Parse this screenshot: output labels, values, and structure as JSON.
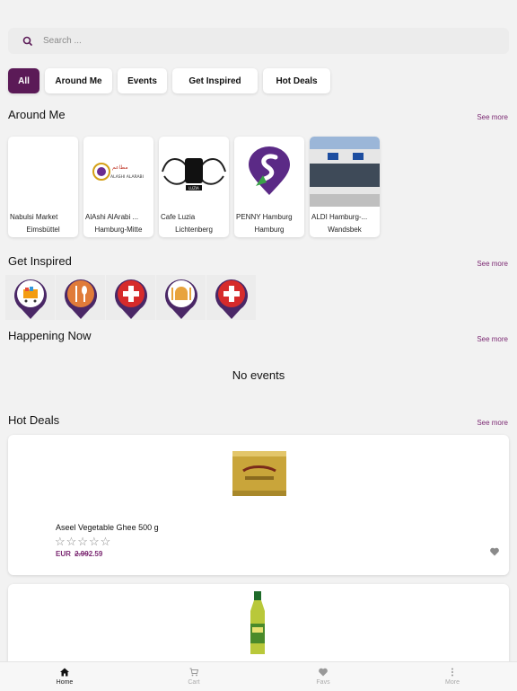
{
  "search": {
    "placeholder": "Search ..."
  },
  "tabs": [
    "All",
    "Around Me",
    "Events",
    "Get Inspired",
    "Hot Deals"
  ],
  "around_me": {
    "title": "Around Me",
    "see_more": "See more",
    "places": [
      {
        "name": "Nabulsi Market",
        "area": "Eimsbüttel"
      },
      {
        "name": "AlAshi AlArabi ...",
        "area": "Hamburg-Mitte",
        "logo_text": "ALASHI ALARABI"
      },
      {
        "name": "Cafe Luzia",
        "area": "Lichtenberg",
        "logo_text": "LUZIA"
      },
      {
        "name": "PENNY Hamburg",
        "area": "Hamburg"
      },
      {
        "name": "ALDI Hamburg-...",
        "area": "Wandsbek"
      }
    ]
  },
  "get_inspired": {
    "title": "Get Inspired",
    "see_more": "See more",
    "icons": [
      "shopping-cart-pin-icon",
      "restaurant-pin-icon",
      "medical-pin-icon",
      "mosque-pin-icon",
      "medical-pin-icon"
    ]
  },
  "happening_now": {
    "title": "Happening Now",
    "see_more": "See more",
    "empty_text": "No events"
  },
  "hot_deals": {
    "title": "Hot Deals",
    "see_more": "See more",
    "items": [
      {
        "name": "Aseel Vegetable Ghee 500 g",
        "currency": "EUR",
        "price_new": "2.99",
        "price_old": "2.59",
        "rating": 0
      }
    ]
  },
  "bottom_nav": [
    {
      "label": "Home",
      "icon": "home-icon",
      "active": true
    },
    {
      "label": "Cart",
      "icon": "cart-icon",
      "active": false
    },
    {
      "label": "Favs",
      "icon": "heart-icon",
      "active": false
    },
    {
      "label": "More",
      "icon": "more-vertical-icon",
      "active": false
    }
  ],
  "colors": {
    "accent": "#5b1a57",
    "link": "#7c2a73",
    "background": "#f2f2f2"
  }
}
